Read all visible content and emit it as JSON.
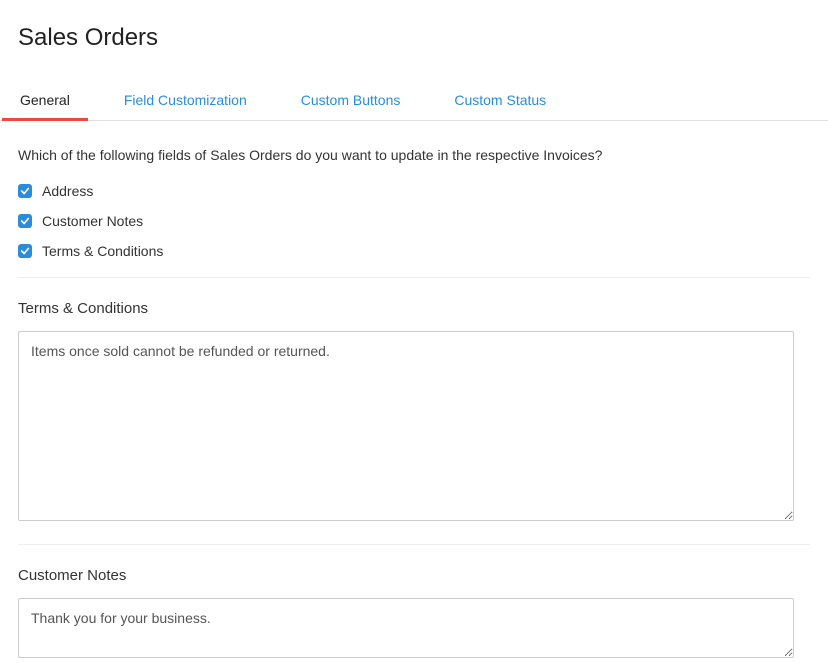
{
  "title": "Sales Orders",
  "tabs": [
    {
      "label": "General",
      "active": true
    },
    {
      "label": "Field Customization",
      "active": false
    },
    {
      "label": "Custom Buttons",
      "active": false
    },
    {
      "label": "Custom Status",
      "active": false
    }
  ],
  "question": "Which of the following fields of Sales Orders do you want to update in the respective Invoices?",
  "checks": [
    {
      "label": "Address",
      "checked": true
    },
    {
      "label": "Customer Notes",
      "checked": true
    },
    {
      "label": "Terms & Conditions",
      "checked": true
    }
  ],
  "sections": {
    "terms": {
      "label": "Terms & Conditions",
      "value": "Items once sold cannot be refunded or returned."
    },
    "notes": {
      "label": "Customer Notes",
      "value": "Thank you for your business."
    }
  }
}
